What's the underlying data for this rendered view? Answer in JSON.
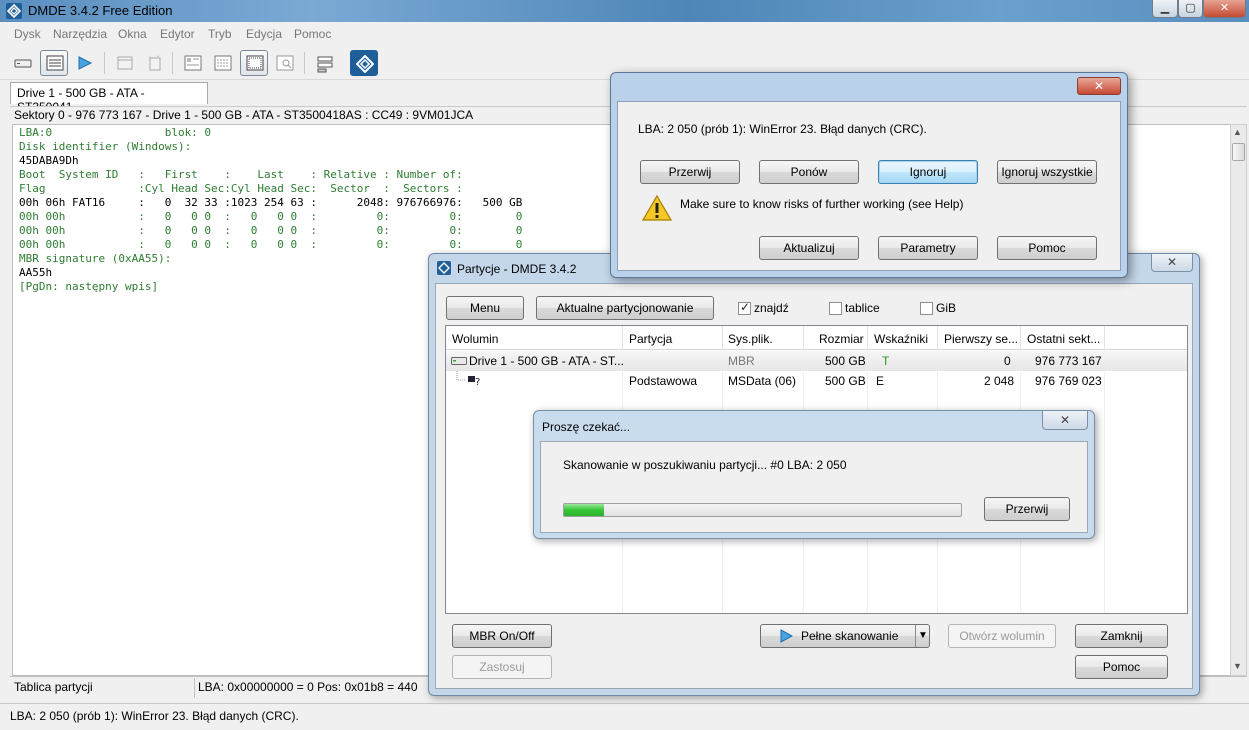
{
  "main_window": {
    "title": "DMDE 3.4.2 Free Edition",
    "min_label": "▁",
    "max_label": "▢",
    "close_label": "✕"
  },
  "menu": [
    "Dysk",
    "Narzędzia",
    "Okna",
    "Edytor",
    "Tryb",
    "Edycja",
    "Pomoc"
  ],
  "tabs": {
    "drive": "Drive 1 - 500 GB - ATA - ST350041..."
  },
  "sector_line": "Sektory 0 - 976 773 167 - Drive 1 - 500 GB - ATA - ST3500418AS : CC49 : 9VM01JCA",
  "hex_view": {
    "l1": "LBA:0                 blok: 0",
    "l2": "Disk identifier (Windows):",
    "l3": "45DABA9Dh",
    "l4": "Boot  System ID   :   First    :    Last    : Relative : Number of:",
    "l5": "Flag              :Cyl Head Sec:Cyl Head Sec:  Sector  :  Sectors :",
    "l6": "00h 06h FAT16     :   0  32 33 :1023 254 63 :      2048: 976766976:   500 GB",
    "l7": "00h 00h           :   0   0 0  :   0   0 0  :         0:         0:        0",
    "l8": "00h 00h           :   0   0 0  :   0   0 0  :         0:         0:        0",
    "l9": "00h 00h           :   0   0 0  :   0   0 0  :         0:         0:        0",
    "l10": "MBR signature (0xAA55):",
    "l11": "AA55h",
    "l12": "[PgDn: następny wpis]"
  },
  "status": {
    "left": "Tablica partycji",
    "right": "LBA: 0x00000000 = 0  Pos: 0x01b8 = 440",
    "bottom": "LBA: 2 050 (prób 1): WinError 23. Błąd danych (CRC)."
  },
  "error_dialog": {
    "close_label": "✕",
    "message": "LBA: 2 050 (prób 1): WinError 23. Błąd danych (CRC).",
    "buttons": {
      "abort": "Przerwij",
      "retry": "Ponów",
      "ignore": "Ignoruj",
      "ignore_all": "Ignoruj wszystkie"
    },
    "warning": "Make sure to know risks of further working (see Help)",
    "buttons2": {
      "update": "Aktualizuj",
      "params": "Parametry",
      "help": "Pomoc"
    }
  },
  "partitions_dialog": {
    "title": "Partycje - DMDE 3.4.2",
    "close_label": "✕",
    "menu_button": "Menu",
    "current_partitioning_button": "Aktualne partycjonowanie",
    "checks": {
      "find": "znajdź",
      "find_checked": true,
      "tables": "tablice",
      "tables_checked": false,
      "gib": "GiB",
      "gib_checked": false
    },
    "columns": [
      "Wolumin",
      "Partycja",
      "Sys.plik.",
      "Rozmiar",
      "Wskaźniki",
      "Pierwszy se...",
      "Ostatni sekt..."
    ],
    "rows": [
      {
        "wolumin": "Drive 1 - 500 GB - ATA - ST...",
        "partycja": "",
        "sys": "MBR",
        "rozmiar": "500 GB",
        "wskazniki": "T",
        "pierwszy": "0",
        "ostatni": "976 773 167"
      },
      {
        "wolumin": "",
        "partycja": "Podstawowa",
        "sys": "MSData (06)",
        "rozmiar": "500 GB",
        "wskazniki": "E",
        "pierwszy": "2 048",
        "ostatni": "976 769 023"
      }
    ],
    "buttons": {
      "mbr_onoff": "MBR On/Off",
      "apply": "Zastosuj",
      "full_scan": "Pełne skanowanie",
      "open_volume": "Otwórz wolumin",
      "close": "Zamknij",
      "help": "Pomoc"
    }
  },
  "progress_dialog": {
    "title": "Proszę czekać...",
    "close_label": "✕",
    "message": "Skanowanie w poszukiwaniu partycji...  #0  LBA: 2 050",
    "progress_fraction": 0.1,
    "abort_button": "Przerwij"
  },
  "colors": {
    "hex_text": "#2e7d32",
    "progress": "#37c437",
    "title_blue": "#5b8fc0"
  },
  "icons": [
    "dmde-app-icon",
    "warning-icon",
    "play-icon",
    "disk-icon",
    "list-icon"
  ]
}
